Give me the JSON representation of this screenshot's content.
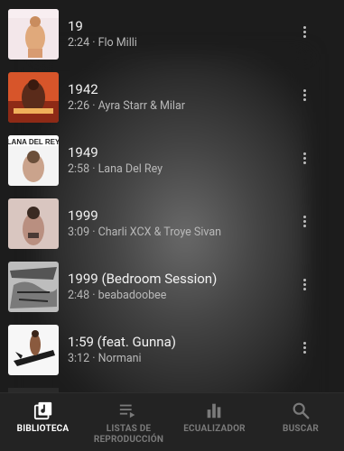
{
  "tracks": [
    {
      "title": "19",
      "duration": "2:24",
      "artist": "Flo Milli",
      "meta": "2:24 · Flo Milli"
    },
    {
      "title": "1942",
      "duration": "2:26",
      "artist": "Ayra Starr & Milar",
      "meta": "2:26 · Ayra Starr & Milar"
    },
    {
      "title": "1949",
      "duration": "2:58",
      "artist": "Lana Del Rey",
      "meta": "2:58 · Lana Del Rey"
    },
    {
      "title": "1999",
      "duration": "3:09",
      "artist": "Charli XCX & Troye Sivan",
      "meta": "3:09 · Charli XCX & Troye Sivan"
    },
    {
      "title": "1999 (Bedroom Session)",
      "duration": "2:48",
      "artist": "beabadoobee",
      "meta": "2:48 · beabadoobee"
    },
    {
      "title": "1:59 (feat. Gunna)",
      "duration": "3:12",
      "artist": "Normani",
      "meta": "3:12 · Normani"
    }
  ],
  "nav": {
    "library": "BIBLIOTECA",
    "playlists_line1": "LISTAS DE",
    "playlists_line2": "REPRODUCCIÓN",
    "equalizer": "ECUALIZADOR",
    "search": "BUSCAR"
  },
  "colors": {
    "background": "#1c1c1c",
    "navbar": "#232323",
    "active_nav": "#ffffff",
    "inactive_nav": "#7a7a7a"
  }
}
